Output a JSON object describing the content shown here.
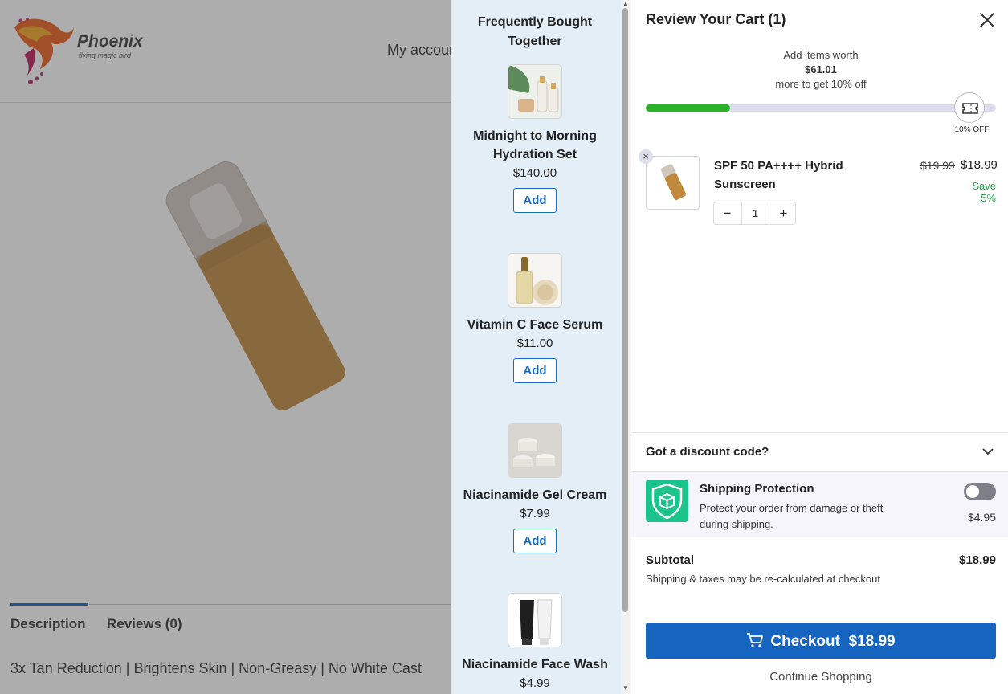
{
  "background": {
    "logo": {
      "name": "Phoenix",
      "tagline": "flying magic bird"
    },
    "nav": {
      "my_account": "My accoun"
    },
    "tabs": [
      {
        "label": "Description"
      },
      {
        "label": "Reviews (0)"
      }
    ],
    "description_text": "3x Tan Reduction | Brightens Skin | Non-Greasy | No White Cast"
  },
  "upsell": {
    "title_line1": "Frequently Bought",
    "title_line2": "Together",
    "items": [
      {
        "name": "Midnight to Morning Hydration Set",
        "price": "$140.00",
        "add_label": "Add",
        "thumb": "skincare-set-icon"
      },
      {
        "name": "Vitamin C Face Serum",
        "price": "$11.00",
        "add_label": "Add",
        "thumb": "serum-bottle-icon"
      },
      {
        "name": "Niacinamide Gel Cream",
        "price": "$7.99",
        "add_label": "Add",
        "thumb": "cream-jars-icon"
      },
      {
        "name": "Niacinamide Face Wash",
        "price": "$4.99",
        "add_label": "Add",
        "thumb": "face-wash-tubes-icon"
      }
    ]
  },
  "cart": {
    "title": "Review Your Cart (1)",
    "progress": {
      "line1": "Add items worth",
      "amount": "$61.01",
      "line3": "more to get 10% off",
      "fraction": 0.24,
      "milestone_label": "10% OFF"
    },
    "line_items": [
      {
        "name": "SPF 50 PA++++ Hybrid Sunscreen",
        "original_price": "$19.99",
        "price": "$18.99",
        "savings": "Save 5%",
        "quantity": "1",
        "minus": "−",
        "plus": "+",
        "remove": "×"
      }
    ],
    "discount": {
      "label": "Got a discount code?"
    },
    "shipping_protection": {
      "title": "Shipping Protection",
      "description": "Protect your order from damage or theft during shipping.",
      "price": "$4.95",
      "enabled": false
    },
    "subtotal": {
      "label": "Subtotal",
      "value": "$18.99",
      "note": "Shipping & taxes may be re-calculated at checkout"
    },
    "checkout": {
      "label": "Checkout",
      "amount": "$18.99"
    },
    "continue_label": "Continue Shopping"
  },
  "colors": {
    "accent": "#1565c0",
    "progress": "#2bb12b",
    "savings": "#2ea44f",
    "upsell_bg": "#e3eef7",
    "shield": "#1cc38a"
  }
}
